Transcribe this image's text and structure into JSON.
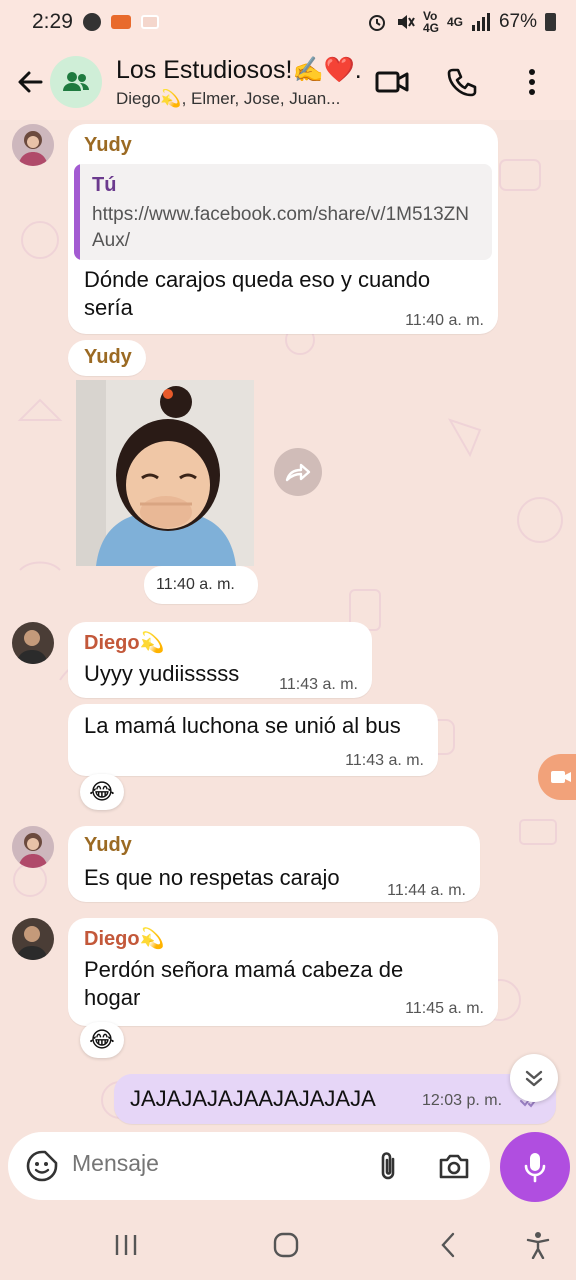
{
  "status_bar": {
    "time": "2:29",
    "network": "4G",
    "battery": "67%"
  },
  "header": {
    "title": "Los Estudiosos!✍️❤️.",
    "subtitle": "Diego💫, Elmer, Jose, Juan..."
  },
  "messages": [
    {
      "sender": "Yudy",
      "quote_author": "Tú",
      "quote_text": "https://www.facebook.com/share/v/1M513ZNAux/",
      "text": "Dónde carajos queda eso y cuando sería",
      "time": "11:40 a. m."
    },
    {
      "sender": "Yudy",
      "type": "sticker",
      "time": "11:40 a. m."
    },
    {
      "sender": "Diego💫",
      "text": "Uyyy yudiisssss",
      "time": "11:43 a. m."
    },
    {
      "text": "La mamá luchona se unió al bus",
      "time": "11:43 a. m.",
      "reaction": "😂"
    },
    {
      "sender": "Yudy",
      "text": "Es que no respetas carajo",
      "time": "11:44 a. m."
    },
    {
      "sender": "Diego💫",
      "text": "Perdón señora mamá cabeza de hogar",
      "time": "11:45 a. m.",
      "reaction": "😂"
    },
    {
      "outgoing": true,
      "text": "JAJAJAJAJAAJAJAJAJA",
      "time": "12:03 p. m."
    }
  ],
  "input": {
    "placeholder": "Mensaje"
  },
  "colors": {
    "accent": "#b04ee0",
    "yudy_name": "#9b6a23",
    "diego_name": "#c3583a",
    "background": "#f7e3dc"
  }
}
